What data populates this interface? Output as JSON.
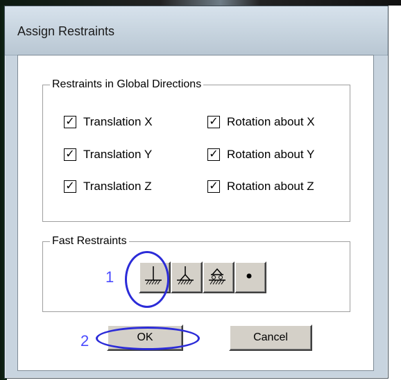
{
  "dialog": {
    "title": "Assign Restraints"
  },
  "global_directions": {
    "group_label": "Restraints in Global Directions",
    "checkboxes": [
      {
        "label": "Translation X",
        "checked": true
      },
      {
        "label": "Rotation about X",
        "checked": true
      },
      {
        "label": "Translation Y",
        "checked": true
      },
      {
        "label": "Rotation about Y",
        "checked": true
      },
      {
        "label": "Translation Z",
        "checked": true
      },
      {
        "label": "Rotation about Z",
        "checked": true
      }
    ]
  },
  "fast_restraints": {
    "group_label": "Fast Restraints",
    "buttons": [
      {
        "icon": "fixed-support-icon"
      },
      {
        "icon": "pinned-support-icon"
      },
      {
        "icon": "roller-support-icon"
      },
      {
        "icon": "free-node-icon"
      }
    ]
  },
  "annotations": {
    "step1": "1",
    "step2": "2"
  },
  "buttons": {
    "ok": "OK",
    "cancel": "Cancel"
  },
  "colors": {
    "annotation": "#2b2bd8"
  }
}
